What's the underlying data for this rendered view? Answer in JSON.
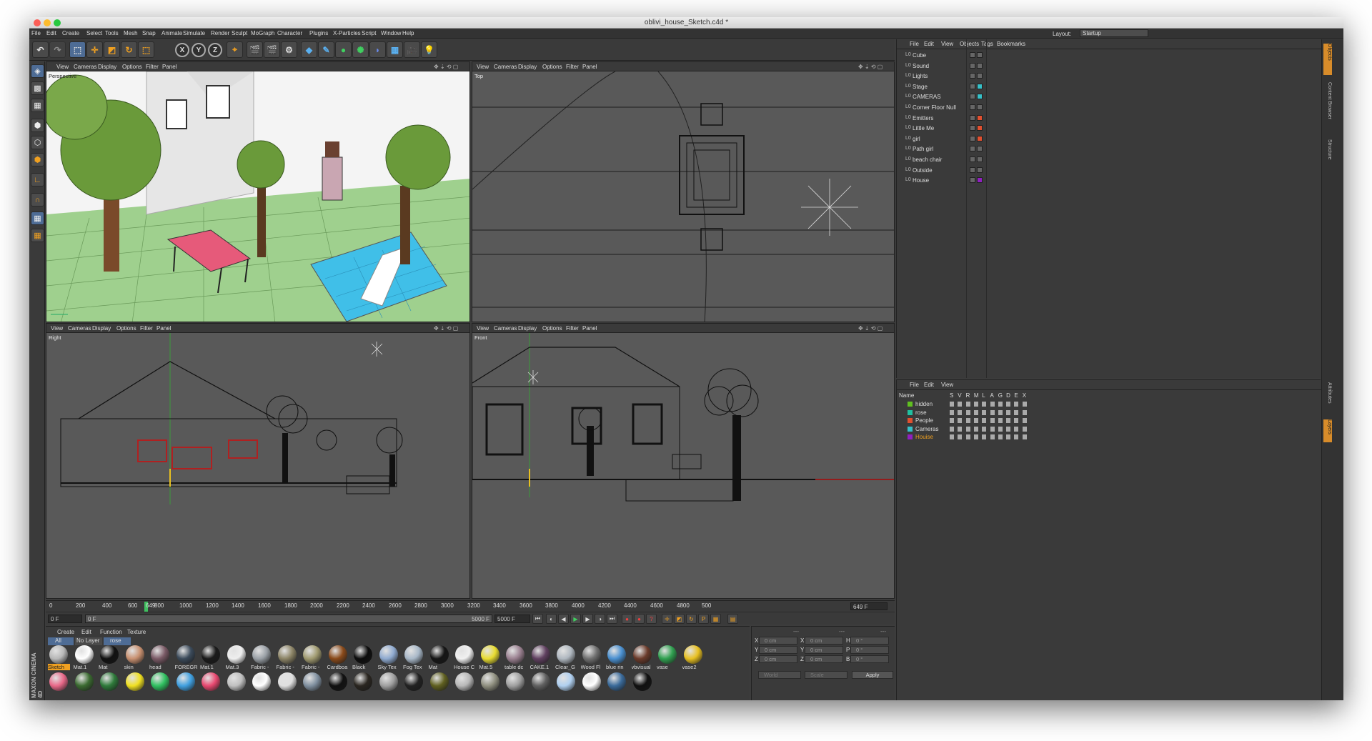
{
  "window": {
    "title": "oblivi_house_Sketch.c4d *"
  },
  "menu": {
    "items": [
      "File",
      "Edit",
      "Create",
      "Select",
      "Tools",
      "Mesh",
      "Snap",
      "Animate",
      "Simulate",
      "Render",
      "Sculpt",
      "MoGraph",
      "Character",
      "Plugins",
      "X-Particles",
      "Script",
      "Window",
      "Help"
    ],
    "layout_label": "Layout:",
    "layout_value": "Startup"
  },
  "toolbar": {
    "axis": [
      "X",
      "Y",
      "Z"
    ]
  },
  "viewports": {
    "menu": [
      "View",
      "Cameras",
      "Display",
      "Options",
      "Filter",
      "Panel"
    ],
    "names": [
      "Perspective",
      "Top",
      "Right",
      "Front"
    ]
  },
  "timeline": {
    "ticks": [
      "0",
      "200",
      "400",
      "600",
      "649",
      "800",
      "1000",
      "1200",
      "1400",
      "1600",
      "1800",
      "2000",
      "2200",
      "2400",
      "2600",
      "2800",
      "3000",
      "3200",
      "3400",
      "3600",
      "3800",
      "4000",
      "4200",
      "4400",
      "4600",
      "4800",
      "500"
    ],
    "current_label": "649 F",
    "start_field": "0 F",
    "range_start": "0 F",
    "range_end": "5000 F",
    "end_field": "5000 F"
  },
  "materials": {
    "menu": [
      "Create",
      "Edit",
      "Function",
      "Texture"
    ],
    "filters": [
      "All",
      "No Layer",
      "rose"
    ],
    "row1": [
      {
        "label": "Sketch",
        "color": "#b8b8b8",
        "sel": true
      },
      {
        "label": "Mat.1",
        "color": "#ffffff"
      },
      {
        "label": "Mat",
        "color": "#111111"
      },
      {
        "label": "skin",
        "color": "#c89070"
      },
      {
        "label": "head",
        "color": "#7a5a66"
      },
      {
        "label": "FOREGR",
        "color": "#3b4a5a"
      },
      {
        "label": "Mat.1",
        "color": "#1a1a1a"
      },
      {
        "label": "Mat.3",
        "color": "#eeeeee"
      },
      {
        "label": "Fabric -",
        "color": "#9aa0a6"
      },
      {
        "label": "Fabric -",
        "color": "#8c8466"
      },
      {
        "label": "Fabric -",
        "color": "#a09a70"
      },
      {
        "label": "Cardboa",
        "color": "#8a4a1a"
      },
      {
        "label": "Black",
        "color": "#0c0c0c"
      },
      {
        "label": "Sky Tex",
        "color": "#8faad0"
      },
      {
        "label": "Fog Tex",
        "color": "#a8b8c8"
      },
      {
        "label": "Mat",
        "color": "#151515"
      },
      {
        "label": "House C",
        "color": "#f0f0f0"
      },
      {
        "label": "Mat.5",
        "color": "#e8dc30"
      },
      {
        "label": "table dc",
        "color": "#9a8090"
      },
      {
        "label": "CAKE.1",
        "color": "#604060"
      },
      {
        "label": "Clear_G",
        "color": "#b0b8c0"
      },
      {
        "label": "Wood Fl",
        "color": "#707070"
      },
      {
        "label": "blue rin",
        "color": "#4a90d0"
      },
      {
        "label": "vbvisual",
        "color": "#6a3a2a"
      },
      {
        "label": "vase",
        "color": "#30a050"
      },
      {
        "label": "vase2",
        "color": "#e8c020"
      }
    ],
    "row2": [
      "#e86888",
      "#3a6a30",
      "#2e7a3a",
      "#f0e020",
      "#30c060",
      "#40a0e0",
      "#e84870",
      "#c0c0c0",
      "#ffffff",
      "#e0e0e0",
      "#8090a0",
      "#111111",
      "#2a2620",
      "#a0a0a0",
      "#222222",
      "#606020",
      "#b8b8b8",
      "#909080",
      "#a0a0a0",
      "#606060",
      "#b0d0f0",
      "#ffffff",
      "#3a6a9a",
      "#101010"
    ]
  },
  "coords": {
    "headers": [
      "---",
      "---",
      "---"
    ],
    "rows": [
      {
        "a": "X",
        "av": "0 cm",
        "b": "X",
        "bv": "0 cm",
        "c": "H",
        "cv": "0 °"
      },
      {
        "a": "Y",
        "av": "0 cm",
        "b": "Y",
        "bv": "0 cm",
        "c": "P",
        "cv": "0 °"
      },
      {
        "a": "Z",
        "av": "0 cm",
        "b": "Z",
        "bv": "0 cm",
        "c": "B",
        "cv": "0 °"
      }
    ],
    "space": "World",
    "mode": "Scale",
    "apply": "Apply"
  },
  "objects": {
    "menu": [
      "File",
      "Edit",
      "View",
      "Objects",
      "Tags",
      "Bookmarks"
    ],
    "items": [
      {
        "name": "Cube",
        "color": "#666"
      },
      {
        "name": "Sound",
        "color": "#666"
      },
      {
        "name": "Lights",
        "color": "#666"
      },
      {
        "name": "Stage",
        "color": "#36c0c8"
      },
      {
        "name": "CAMERAS",
        "color": "#36c0c8"
      },
      {
        "name": "Corner Floor Null",
        "color": "#666"
      },
      {
        "name": "Emitters",
        "color": "#e05030"
      },
      {
        "name": "Little Me",
        "color": "#e05030"
      },
      {
        "name": "girl",
        "color": "#e05030"
      },
      {
        "name": "Path girl",
        "color": "#666"
      },
      {
        "name": "beach chair",
        "color": "#666"
      },
      {
        "name": "Outside",
        "color": "#666"
      },
      {
        "name": "House",
        "color": "#9020c0"
      }
    ]
  },
  "layers": {
    "menu": [
      "File",
      "Edit",
      "View"
    ],
    "header": "Name",
    "cols": [
      "S",
      "V",
      "R",
      "M",
      "L",
      "A",
      "G",
      "D",
      "E",
      "X"
    ],
    "items": [
      {
        "name": "hidden",
        "color": "#60c020"
      },
      {
        "name": "rose",
        "color": "#20c0a0"
      },
      {
        "name": "People",
        "color": "#e05030"
      },
      {
        "name": "Cameras",
        "color": "#36c0c8"
      },
      {
        "name": "Houise",
        "color": "#9020c0",
        "sel": true
      }
    ]
  },
  "right_tabs": [
    "Objects",
    "Content Browser",
    "Structure",
    "Attributes",
    "Layers"
  ],
  "brand": "MAXON CINEMA 4D"
}
